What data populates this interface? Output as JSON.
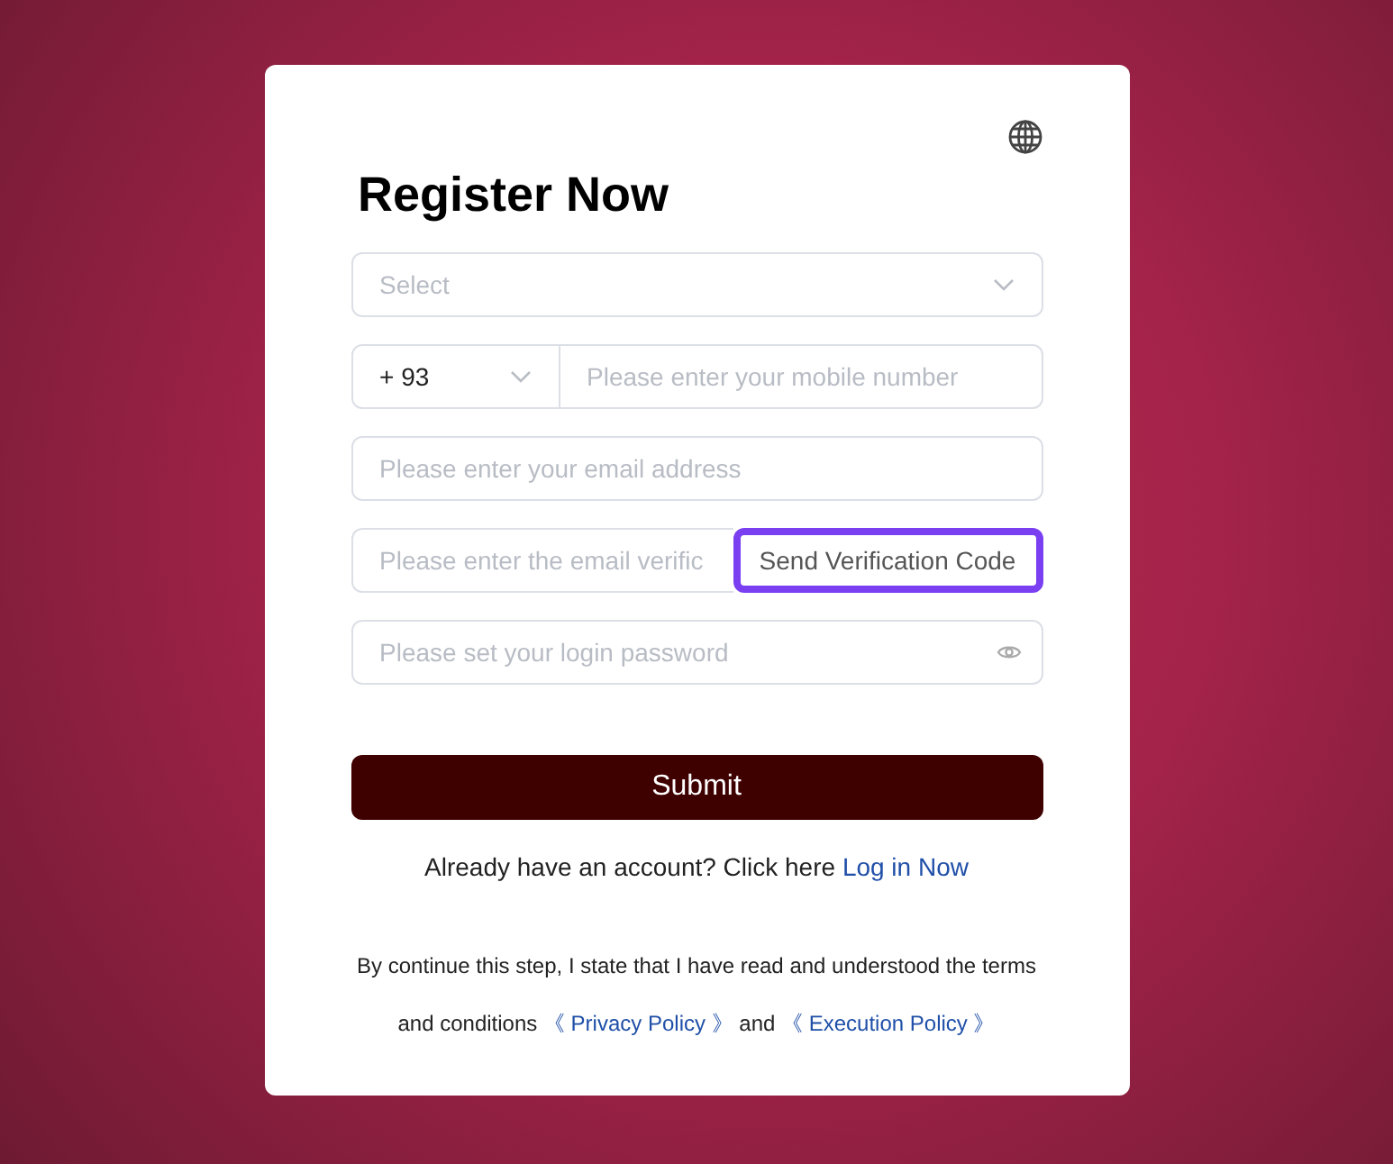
{
  "title": "Register Now",
  "region_select": {
    "placeholder": "Select"
  },
  "phone": {
    "country_code": "+ 93",
    "placeholder": "Please enter your mobile number"
  },
  "email": {
    "placeholder": "Please enter your email address"
  },
  "verification": {
    "placeholder": "Please enter the email verific",
    "button": "Send Verification Code",
    "highlighted": true
  },
  "password": {
    "placeholder": "Please set your login password"
  },
  "submit": "Submit",
  "login_prompt": {
    "text": "Already have an account? Click here",
    "link": "Log in Now"
  },
  "terms": {
    "text_before": "By continue this step, I state that I have read and understood the terms and conditions",
    "privacy_link": "《 Privacy Policy 》",
    "joiner": "and",
    "execution_link": "《 Execution Policy 》"
  }
}
